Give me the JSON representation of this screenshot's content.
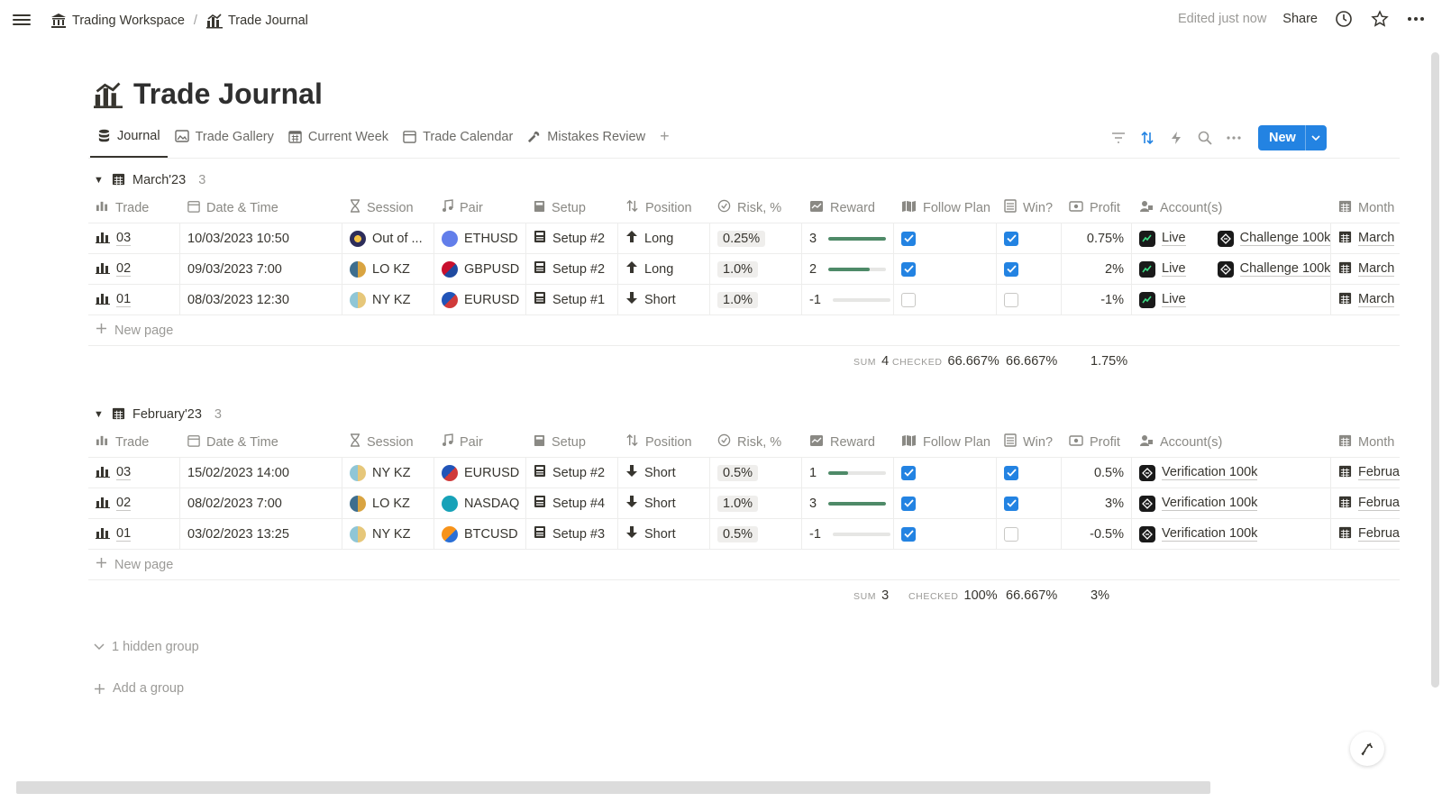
{
  "breadcrumb": {
    "workspace": "Trading Workspace",
    "separator": "/",
    "page": "Trade Journal"
  },
  "topbar": {
    "edited": "Edited just now",
    "share": "Share"
  },
  "page": {
    "title": "Trade Journal"
  },
  "tabs": [
    {
      "label": "Journal",
      "icon": "database-icon",
      "active": true
    },
    {
      "label": "Trade Gallery",
      "icon": "gallery-icon"
    },
    {
      "label": "Current Week",
      "icon": "calendar-icon"
    },
    {
      "label": "Trade Calendar",
      "icon": "calendar-icon"
    },
    {
      "label": "Mistakes Review",
      "icon": "wrench-icon"
    }
  ],
  "toolbar": {
    "new_label": "New"
  },
  "columns": [
    "Trade",
    "Date & Time",
    "Session",
    "Pair",
    "Setup",
    "Position",
    "Risk, %",
    "Reward",
    "Follow Plan",
    "Win?",
    "Profit",
    "Account(s)",
    "Month"
  ],
  "groups": [
    {
      "name": "March'23",
      "count": "3",
      "rows": [
        {
          "trade": "03",
          "date": "10/03/2023 10:50",
          "session": "Out of ...",
          "pair": "ETHUSD",
          "setup": "Setup #2",
          "position": "Long",
          "risk": "0.25%",
          "reward": "3",
          "reward_fill": 1.0,
          "follow": true,
          "win": true,
          "profit": "0.75%",
          "acc1": "Live",
          "acc2": "Challenge 100k",
          "month": "March"
        },
        {
          "trade": "02",
          "date": "09/03/2023 7:00",
          "session": "LO KZ",
          "pair": "GBPUSD",
          "setup": "Setup #2",
          "position": "Long",
          "risk": "1.0%",
          "reward": "2",
          "reward_fill": 0.72,
          "follow": true,
          "win": true,
          "profit": "2%",
          "acc1": "Live",
          "acc2": "Challenge 100k",
          "month": "March"
        },
        {
          "trade": "01",
          "date": "08/03/2023 12:30",
          "session": "NY KZ",
          "pair": "EURUSD",
          "setup": "Setup #1",
          "position": "Short",
          "risk": "1.0%",
          "reward": "-1",
          "reward_fill": 0.0,
          "follow": false,
          "win": false,
          "profit": "-1%",
          "acc1": "Live",
          "acc2": "",
          "month": "March"
        }
      ],
      "summary": {
        "sum_key": "SUM",
        "sum": "4",
        "checked_key": "CHECKED",
        "follow": "66.667%",
        "win": "66.667%",
        "profit": "1.75%"
      }
    },
    {
      "name": "February'23",
      "count": "3",
      "rows": [
        {
          "trade": "03",
          "date": "15/02/2023 14:00",
          "session": "NY KZ",
          "pair": "EURUSD",
          "setup": "Setup #2",
          "position": "Short",
          "risk": "0.5%",
          "reward": "1",
          "reward_fill": 0.35,
          "follow": true,
          "win": true,
          "profit": "0.5%",
          "acc1": "Verification 100k",
          "acc2": "",
          "month": "Februa"
        },
        {
          "trade": "02",
          "date": "08/02/2023 7:00",
          "session": "LO KZ",
          "pair": "NASDAQ",
          "setup": "Setup #4",
          "position": "Short",
          "risk": "1.0%",
          "reward": "3",
          "reward_fill": 1.0,
          "follow": true,
          "win": true,
          "profit": "3%",
          "acc1": "Verification 100k",
          "acc2": "",
          "month": "Februa"
        },
        {
          "trade": "01",
          "date": "03/02/2023 13:25",
          "session": "NY KZ",
          "pair": "BTCUSD",
          "setup": "Setup #3",
          "position": "Short",
          "risk": "0.5%",
          "reward": "-1",
          "reward_fill": 0.0,
          "follow": true,
          "win": false,
          "profit": "-0.5%",
          "acc1": "Verification 100k",
          "acc2": "",
          "month": "Februa"
        }
      ],
      "summary": {
        "sum_key": "SUM",
        "sum": "3",
        "checked_key": "CHECKED",
        "follow": "100%",
        "win": "66.667%",
        "profit": "3%"
      }
    }
  ],
  "new_page_label": "New page",
  "hidden_group": "1 hidden group",
  "add_group": "Add a group",
  "colors": {
    "accent": "#2383e2",
    "reward_bar": "#4e8a68",
    "text": "#37352f",
    "muted": "#9b9a97"
  }
}
